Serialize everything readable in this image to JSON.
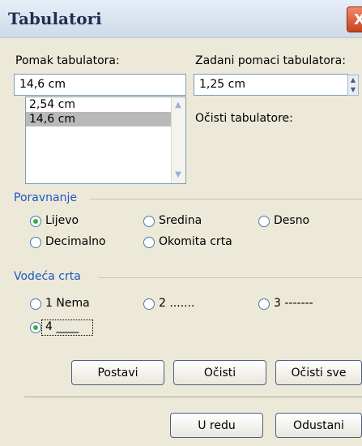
{
  "window": {
    "title": "Tabulatori",
    "close_label": "X"
  },
  "tab_position": {
    "label": "Pomak tabulatora:",
    "value": "14,6 cm",
    "list": [
      "2,54 cm",
      "14,6 cm"
    ],
    "selected_index": 1
  },
  "default_tab": {
    "label": "Zadani pomaci tabulatora:",
    "value": "1,25 cm"
  },
  "clear_label": "Očisti tabulatore:",
  "alignment": {
    "group_label": "Poravnanje",
    "options": [
      "Lijevo",
      "Sredina",
      "Desno",
      "Decimalno",
      "Okomita crta"
    ],
    "selected": "Lijevo"
  },
  "leader": {
    "group_label": "Vodeća crta",
    "options": [
      "1 Nema",
      "2 .......",
      "3 -------",
      "4 ____"
    ],
    "selected": "4 ____"
  },
  "buttons": {
    "set": "Postavi",
    "clear": "Očisti",
    "clear_all": "Očisti sve",
    "ok": "U redu",
    "cancel": "Odustani"
  }
}
